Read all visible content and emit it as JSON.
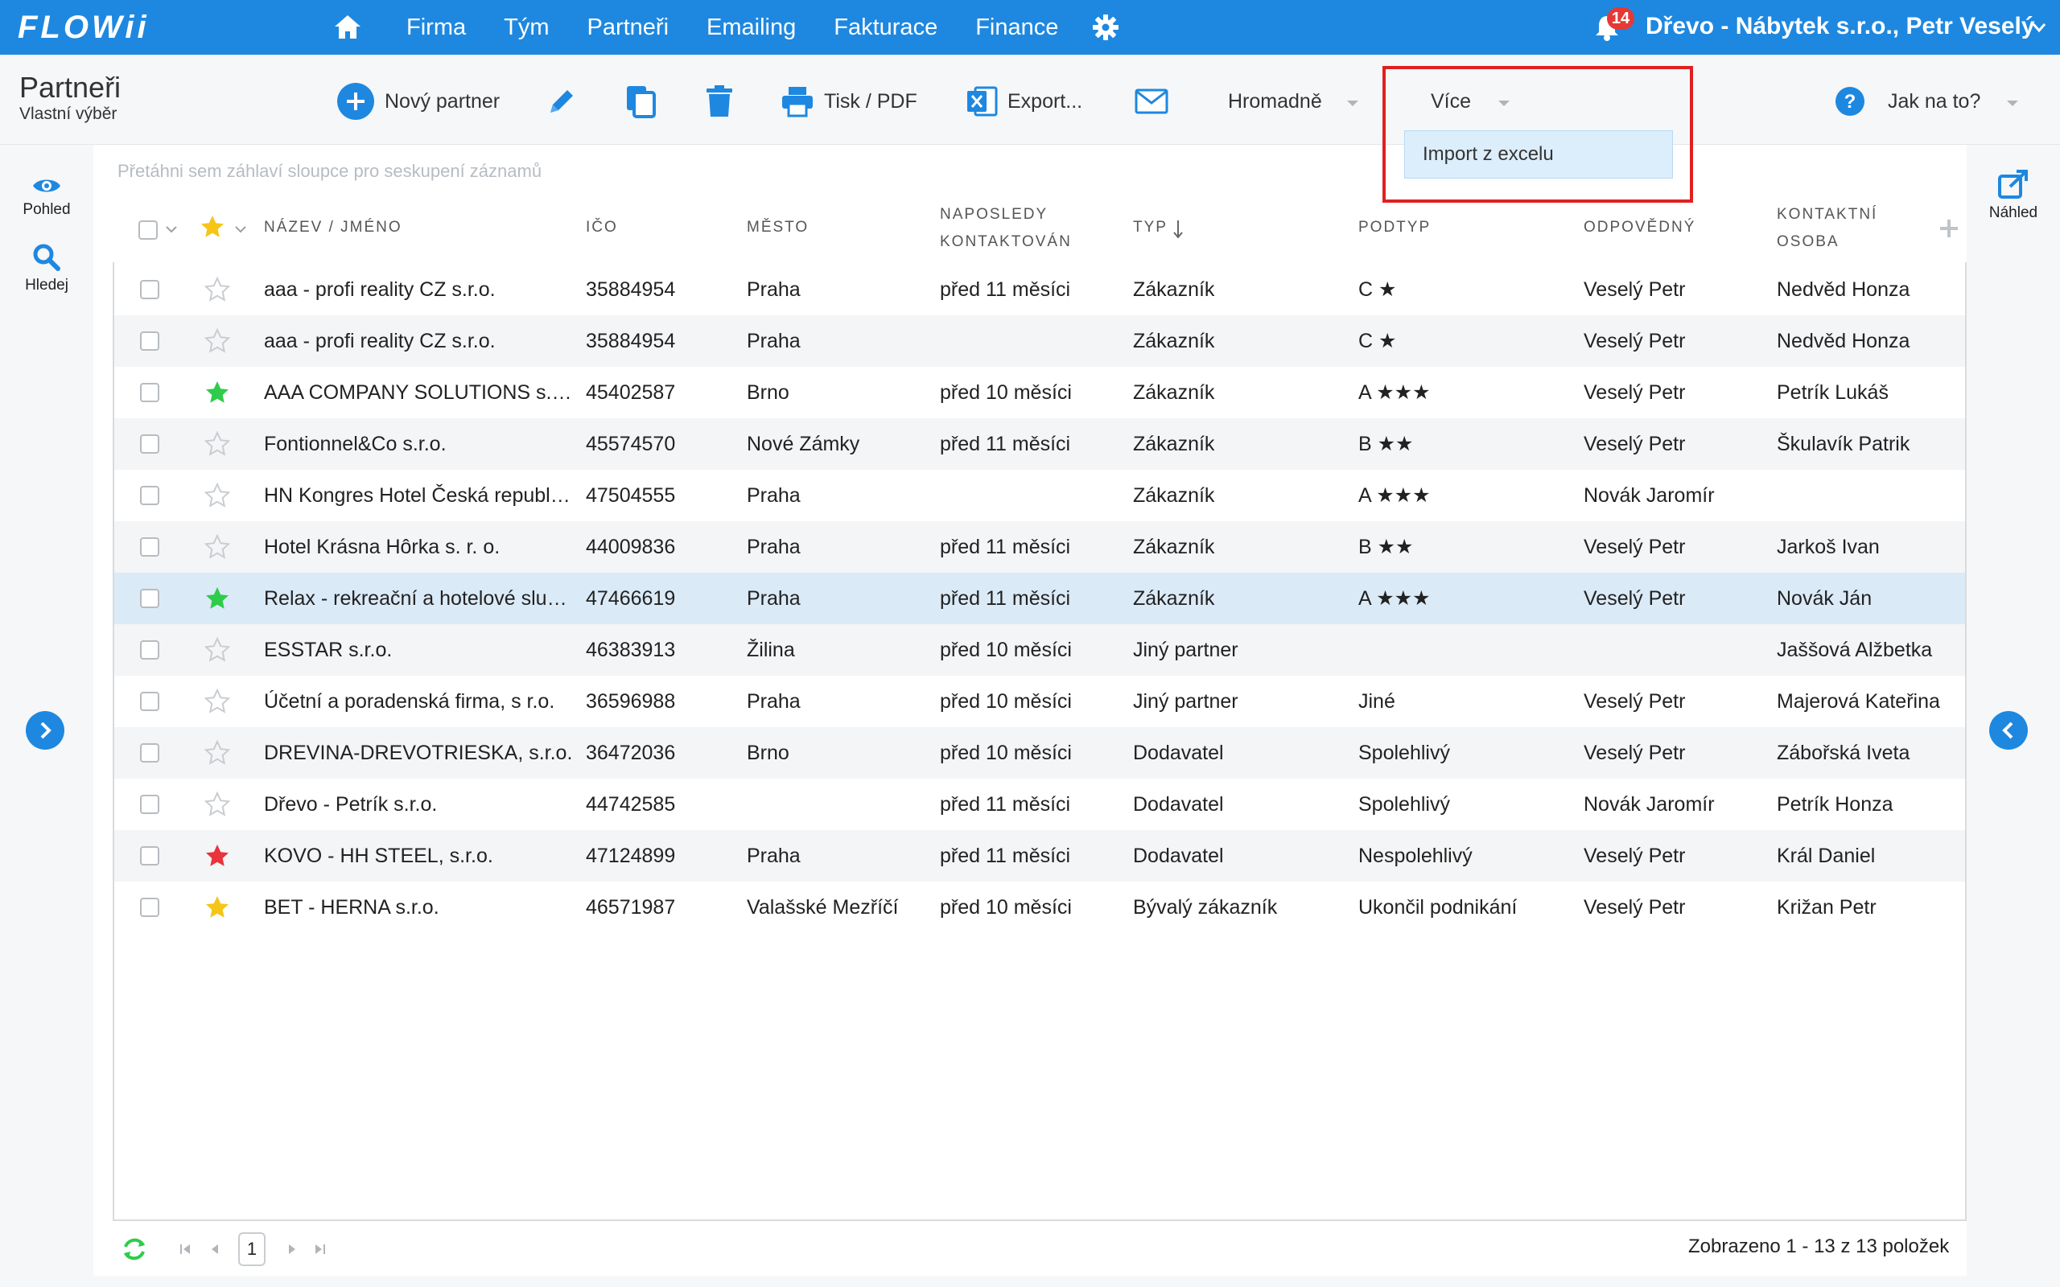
{
  "topbar": {
    "logo": "FLOWii",
    "nav": [
      "Firma",
      "Tým",
      "Partneři",
      "Emailing",
      "Fakturace",
      "Finance"
    ],
    "notifications": "14",
    "company": "Dřevo - Nábytek s.r.o., Petr Veselý",
    "color": "#1e88e0"
  },
  "page": {
    "title": "Partneři",
    "subtitle": "Vlastní výběr"
  },
  "toolbar": {
    "new_partner": "Nový partner",
    "print": "Tisk / PDF",
    "export": "Export...",
    "bulk": "Hromadně",
    "more": "Více",
    "help": "Jak na to?",
    "more_menu": [
      "Import z excelu"
    ]
  },
  "sidebar": {
    "view": "Pohled",
    "search": "Hledej",
    "preview": "Náhled"
  },
  "grid": {
    "group_hint": "Přetáhni sem záhlaví sloupce pro seskupení záznamů",
    "columns": {
      "name": "NÁZEV / JMÉNO",
      "ico": "IČO",
      "city": "MĚSTO",
      "last_contact_1": "NAPOSLEDY",
      "last_contact_2": "KONTAKTOVÁN",
      "type": "TYP",
      "subtype": "PODTYP",
      "owner": "ODPOVĚDNÝ",
      "contact_1": "KONTAKTNÍ",
      "contact_2": "OSOBA"
    },
    "rows": [
      {
        "star": "none",
        "name": "aaa - profi reality CZ s.r.o.",
        "ico": "35884954",
        "city": "Praha",
        "last": "před 11 měsíci",
        "type": "Zákazník",
        "subtype": "C ★",
        "owner": "Veselý Petr",
        "contact": "Nedvěd Honza"
      },
      {
        "star": "none",
        "name": "aaa - profi reality CZ s.r.o.",
        "ico": "35884954",
        "city": "Praha",
        "last": "",
        "type": "Zákazník",
        "subtype": "C ★",
        "owner": "Veselý Petr",
        "contact": "Nedvěd Honza"
      },
      {
        "star": "green",
        "name": "AAA COMPANY SOLUTIONS s.r.o.",
        "ico": "45402587",
        "city": "Brno",
        "last": "před 10 měsíci",
        "type": "Zákazník",
        "subtype": "A ★★★",
        "owner": "Veselý Petr",
        "contact": "Petrík Lukáš"
      },
      {
        "star": "none",
        "name": "Fontionnel&Co s.r.o.",
        "ico": "45574570",
        "city": "Nové Zámky",
        "last": "před 11 měsíci",
        "type": "Zákazník",
        "subtype": "B ★★",
        "owner": "Veselý Petr",
        "contact": "Škulavík Patrik"
      },
      {
        "star": "none",
        "name": "HN Kongres Hotel Česká republika",
        "ico": "47504555",
        "city": "Praha",
        "last": "",
        "type": "Zákazník",
        "subtype": "A ★★★",
        "owner": "Novák Jaromír",
        "contact": ""
      },
      {
        "star": "none",
        "name": "Hotel Krásna Hôrka s. r. o.",
        "ico": "44009836",
        "city": "Praha",
        "last": "před 11 měsíci",
        "type": "Zákazník",
        "subtype": "B ★★",
        "owner": "Veselý Petr",
        "contact": "Jarkoš Ivan"
      },
      {
        "star": "green",
        "name": "Relax - rekreační a hotelové služby",
        "ico": "47466619",
        "city": "Praha",
        "last": "před 11 měsíci",
        "type": "Zákazník",
        "subtype": "A ★★★",
        "owner": "Veselý Petr",
        "contact": "Novák Ján"
      },
      {
        "star": "none",
        "name": "ESSTAR s.r.o.",
        "ico": "46383913",
        "city": "Žilina",
        "last": "před 10 měsíci",
        "type": "Jiný partner",
        "subtype": "",
        "owner": "",
        "contact": "Jaššová Alžbetka"
      },
      {
        "star": "none",
        "name": "Účetní a poradenská firma, s r.o.",
        "ico": "36596988",
        "city": "Praha",
        "last": "před 10 měsíci",
        "type": "Jiný partner",
        "subtype": "Jiné",
        "owner": "Veselý Petr",
        "contact": "Majerová Kateřina"
      },
      {
        "star": "none",
        "name": "DREVINA-DREVOTRIESKA, s.r.o.",
        "ico": "36472036",
        "city": "Brno",
        "last": "před 10 měsíci",
        "type": "Dodavatel",
        "subtype": "Spolehlivý",
        "owner": "Veselý Petr",
        "contact": "Zábořská Iveta"
      },
      {
        "star": "none",
        "name": "Dřevo - Petrík s.r.o.",
        "ico": "44742585",
        "city": "",
        "last": "před 11 měsíci",
        "type": "Dodavatel",
        "subtype": "Spolehlivý",
        "owner": "Novák Jaromír",
        "contact": "Petrík Honza"
      },
      {
        "star": "red",
        "name": "KOVO - HH STEEL, s.r.o.",
        "ico": "47124899",
        "city": "Praha",
        "last": "před 11 měsíci",
        "type": "Dodavatel",
        "subtype": "Nespolehlivý",
        "owner": "Veselý Petr",
        "contact": "Král Daniel"
      },
      {
        "star": "yellow",
        "name": "BET - HERNA s.r.o.",
        "ico": "46571987",
        "city": "Valašské Mezříčí",
        "last": "před 10 měsíci",
        "type": "Bývalý zákazník",
        "subtype": "Ukončil podnikání",
        "owner": "Veselý Petr",
        "contact": "Križan Petr"
      }
    ],
    "selected_row": 6
  },
  "footer": {
    "page": "1",
    "status": "Zobrazeno 1 - 13 z 13 položek"
  },
  "star_colors": {
    "green": "#2ecc4a",
    "red": "#e8343a",
    "yellow": "#f5c518",
    "none": "#c9cdd1"
  }
}
